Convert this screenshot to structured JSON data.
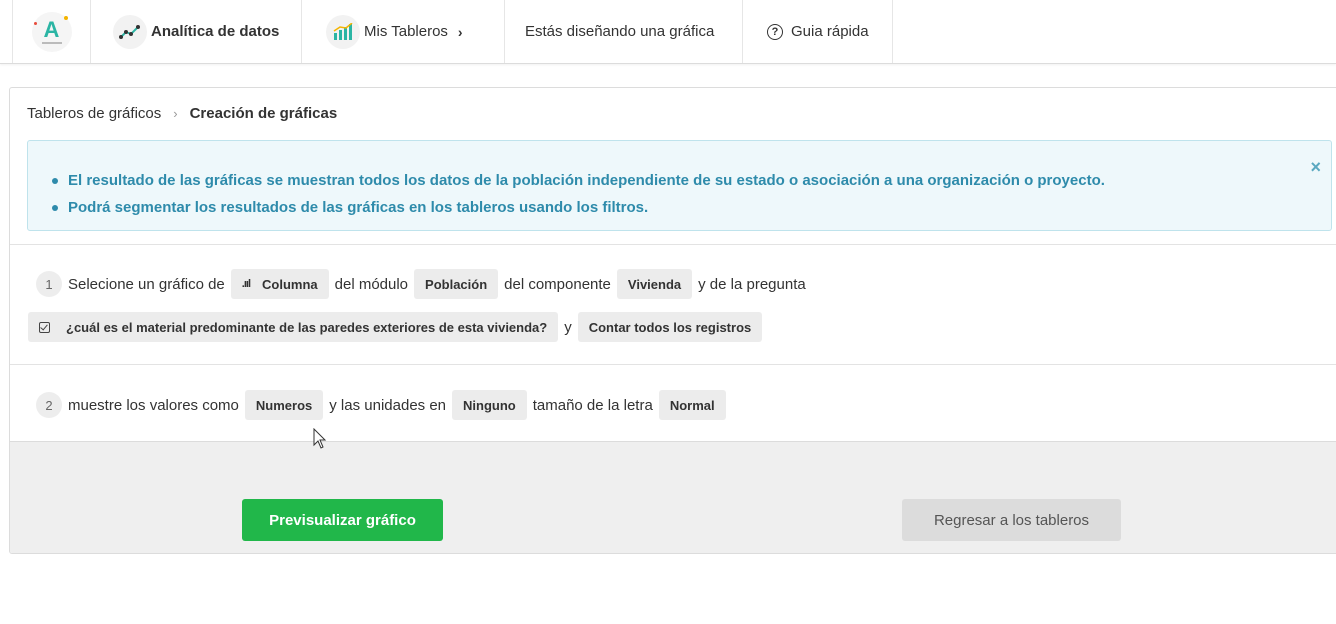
{
  "nav": {
    "logo_letter": "A",
    "analitica": "Analítica de datos",
    "tableros": "Mis Tableros",
    "disenando": "Estás diseñando una gráfica",
    "guia": "Guia rápida",
    "chevron": "›",
    "question": "?"
  },
  "breadcrumb": {
    "parent": "Tableros de gráficos",
    "separator": "›",
    "current": "Creación de gráficas"
  },
  "alert": {
    "items": [
      "El resultado de las gráficas se muestran todos los datos de la población independiente de su estado o asociación a una organización o proyecto.",
      "Podrá segmentar los resultados de las gráficas en los tableros usando los filtros."
    ],
    "close": "×"
  },
  "step1": {
    "number": "1",
    "text_a": "Selecione un gráfico de",
    "chart_type_icon": ".ııl",
    "chart_type": "Columna",
    "text_b": "del módulo",
    "module": "Población",
    "text_c": "del componente",
    "component": "Vivienda",
    "text_d": "y de la pregunta",
    "question": "¿cuál es el material predominante de las paredes exteriores de esta vivienda?",
    "text_e": "y",
    "aggregation": "Contar todos los registros"
  },
  "step2": {
    "number": "2",
    "text_a": "muestre los valores como",
    "values_as": "Numeros",
    "text_b": "y las unidades en",
    "units": "Ninguno",
    "text_c": "tamaño de la letra",
    "font_size": "Normal"
  },
  "actions": {
    "preview": "Previsualizar gráfico",
    "back": "Regresar a los tableros"
  },
  "colors": {
    "accent_green": "#21b74a",
    "info_text": "#2e8bab",
    "info_bg": "#eef8fb"
  }
}
